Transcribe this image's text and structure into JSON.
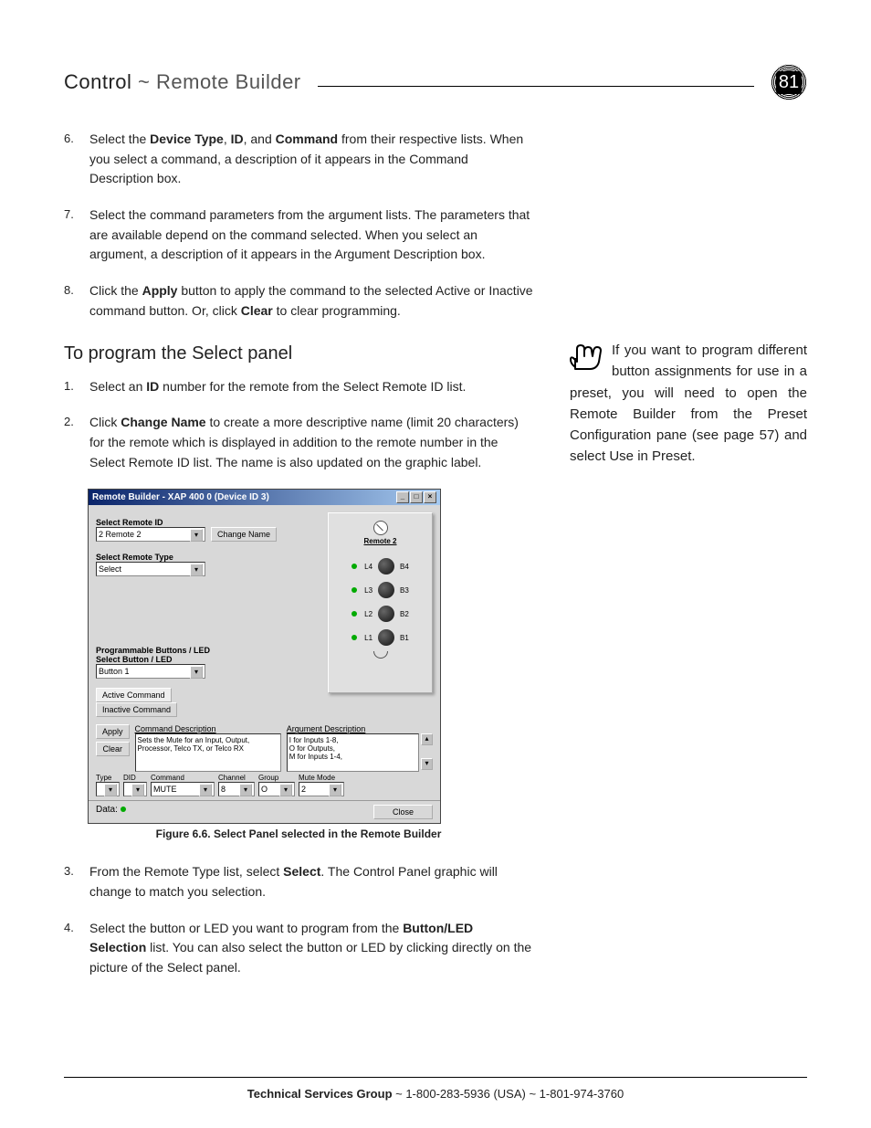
{
  "header": {
    "path_strong": "Control",
    "sep": " ~ ",
    "path_light": "Remote Builder",
    "page_number": "81"
  },
  "steps_a": [
    {
      "n": "6.",
      "html": "Select the <b>Device Type</b>, <b>ID</b>, and <b>Command</b> from their respective lists. When you select a command, a description of it appears in the Command Description box."
    },
    {
      "n": "7.",
      "html": "Select the command parameters from the argument lists. The parameters that are available depend on the command selected. When you select an argument, a description of it appears in the Argument Description box."
    },
    {
      "n": "8.",
      "html": "Click the <b>Apply</b> button to apply the command to the selected Active or Inactive command button. Or, click <b>Clear</b> to clear programming."
    }
  ],
  "section_h2": "To program the Select panel",
  "steps_b": [
    {
      "n": "1.",
      "html": "Select an <b>ID</b> number for the remote from the Select Remote ID list."
    },
    {
      "n": "2.",
      "html": "Click <b>Change Name</b> to create a more descriptive name (limit 20 characters) for the remote which is displayed in addition to the remote number in the Select Remote ID list. The name is also updated on the graphic label."
    }
  ],
  "sidebar_note": "If you want to program different button assignments for use in a preset, you will need to open the Remote Builder from the Preset Configuration pane (see page 57) and select Use in Preset.",
  "window": {
    "title": "Remote Builder - XAP 400 0 (Device ID 3)",
    "lbl_select_remote_id": "Select Remote ID",
    "val_select_remote_id": "2  Remote 2",
    "btn_change_name": "Change Name",
    "lbl_select_remote_type": "Select Remote Type",
    "val_select_remote_type": "Select",
    "lbl_prog_buttons": "Programmable Buttons / LED",
    "lbl_select_button": "Select Button / LED",
    "val_select_button": "Button 1",
    "tab_active": "Active Command",
    "tab_inactive": "Inactive Command",
    "lbl_cmd_desc": "Command Description",
    "val_cmd_desc": "Sets the Mute for an Input, Output, Processor, Telco TX, or Telco RX",
    "lbl_arg_desc": "Argument Description",
    "val_arg_desc": "I for Inputs 1-8,\nO for Outputs,\nM for Inputs 1-4,",
    "btn_apply": "Apply",
    "btn_clear": "Clear",
    "col_type": "Type",
    "col_did": "DID",
    "col_command": "Command",
    "col_channel": "Channel",
    "col_group": "Group",
    "col_mutemode": "Mute Mode",
    "val_command": "MUTE",
    "val_channel": "8",
    "val_group": "O",
    "val_mutemode": "2",
    "remote_name": "Remote 2",
    "leds": [
      "L4",
      "L3",
      "L2",
      "L1"
    ],
    "btns": [
      "B4",
      "B3",
      "B2",
      "B1"
    ],
    "footer_data": "Data:",
    "btn_close": "Close"
  },
  "figure_caption": "Figure 6.6. Select Panel selected in the Remote Builder",
  "steps_c": [
    {
      "n": "3.",
      "html": "From the Remote Type list, select <b>Select</b>. The Control Panel graphic will change to match you selection."
    },
    {
      "n": "4.",
      "html": "Select the button or LED you want to program from the <b>Button/LED Selection</b> list. You can also select the button or LED by clicking directly on the picture of the Select panel."
    }
  ],
  "footer": {
    "group": "Technical Services Group",
    "rest": " ~ 1-800-283-5936 (USA) ~ 1-801-974-3760"
  }
}
